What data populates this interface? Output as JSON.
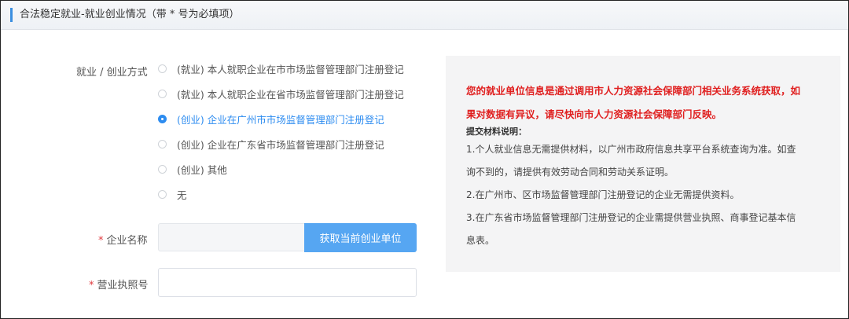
{
  "header": {
    "title": "合法稳定就业-就业创业情况（带 * 号为必填项）"
  },
  "form": {
    "mode_label": "就业 / 创业方式",
    "options": [
      {
        "label": "(就业) 本人就职企业在市市场监督管理部门注册登记",
        "checked": false
      },
      {
        "label": "(就业) 本人就职企业在省市场监督管理部门注册登记",
        "checked": false
      },
      {
        "label": "(创业) 企业在广州市市场监督管理部门注册登记",
        "checked": true
      },
      {
        "label": "(创业) 企业在广东省市场监督管理部门注册登记",
        "checked": false
      },
      {
        "label": "(创业) 其他",
        "checked": false
      },
      {
        "label": "无",
        "checked": false
      }
    ],
    "required_mark": "*",
    "company_name_label": "企业名称",
    "company_name_value": "",
    "fetch_button_label": "获取当前创业单位",
    "license_label": "营业执照号",
    "license_value": ""
  },
  "info": {
    "red_line_1": "您的就业单位信息是通过调用市人力资源社会保障部门相关业务系统获取，如",
    "red_line_2": "果对数据有异议，请尽快向市人力资源社会保障部门反映。",
    "subtitle": "提交材料说明：",
    "line_1a": "1.个人就业信息无需提供材料，以广州市政府信息共享平台系统查询为准。如查",
    "line_1b": "询不到的，请提供有效劳动合同和劳动关系证明。",
    "line_2": "2.在广州市、区市场监督管理部门注册登记的企业无需提供资料。",
    "line_3a": "3.在广东省市场监督管理部门注册登记的企业需提供营业执照、商事登记基本信",
    "line_3b": "息表。"
  },
  "colors": {
    "accent": "#2d8cf0",
    "button": "#56a6f2",
    "warning_red": "#e02020",
    "required_red": "#e0393e"
  }
}
